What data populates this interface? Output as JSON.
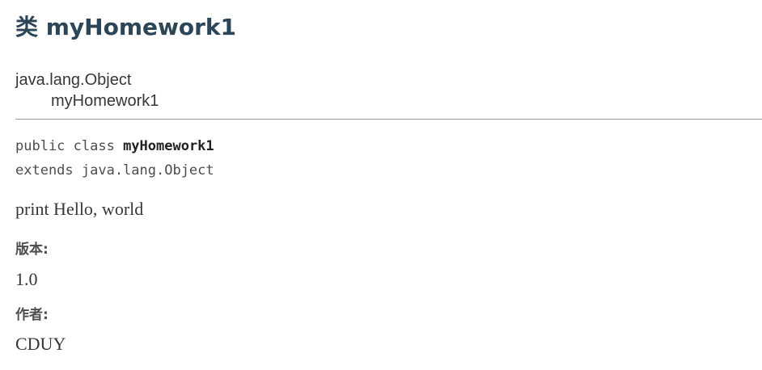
{
  "header": {
    "title": "类 myHomework1"
  },
  "inheritance": {
    "parent": "java.lang.Object",
    "child": "myHomework1"
  },
  "signature": {
    "line1_prefix": "public class ",
    "class_name": "myHomework1",
    "line2": "extends java.lang.Object"
  },
  "description": "print Hello, world",
  "tags": {
    "version_label": "版本:",
    "version_value": "1.0",
    "author_label": "作者:",
    "author_value": "CDUY"
  }
}
